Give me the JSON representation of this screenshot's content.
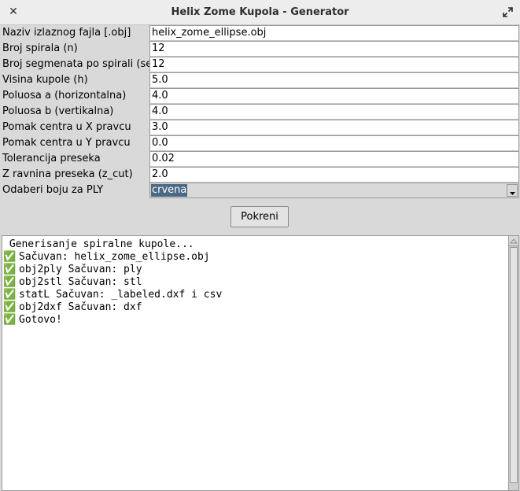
{
  "window": {
    "title": "Helix Zome Kupola - Generator",
    "close_glyph": "✕",
    "icons": {
      "close": "close-icon",
      "maximize": "maximize-icon"
    }
  },
  "form": {
    "fields": [
      {
        "label": "Naziv izlaznog fajla [.obj]",
        "value": "helix_zome_ellipse.obj"
      },
      {
        "label": "Broj spirala (n)",
        "value": "12"
      },
      {
        "label": "Broj segmenata po spirali (segs)",
        "value": "12"
      },
      {
        "label": "Visina kupole (h)",
        "value": "5.0"
      },
      {
        "label": "Poluosa a (horizontalna)",
        "value": "4.0"
      },
      {
        "label": "Poluosa b (vertikalna)",
        "value": "4.0"
      },
      {
        "label": "Pomak centra u X pravcu",
        "value": "3.0"
      },
      {
        "label": "Pomak centra u Y pravcu",
        "value": "0.0"
      },
      {
        "label": "Tolerancija preseka",
        "value": "0.02"
      },
      {
        "label": "Z ravnina preseka (z_cut)",
        "value": "2.0"
      }
    ],
    "color_select": {
      "label": "Odaberi boju za PLY",
      "value": "crvena"
    }
  },
  "run_button": {
    "label": "Pokreni"
  },
  "log": {
    "check_glyph": "✅",
    "lines": [
      {
        "check": false,
        "text": " Generisanje spiralne kupole..."
      },
      {
        "check": true,
        "text": "Sačuvan: helix_zome_ellipse.obj"
      },
      {
        "check": true,
        "text": "obj2ply Sačuvan: ply"
      },
      {
        "check": true,
        "text": "obj2stl Sačuvan: stl"
      },
      {
        "check": true,
        "text": "statL Sačuvan: _labeled.dxf i csv"
      },
      {
        "check": true,
        "text": "obj2dxf Sačuvan: dxf"
      },
      {
        "check": true,
        "text": "Gotovo!"
      }
    ]
  },
  "colors": {
    "selection": "#4a6984",
    "check": "#7aa86a",
    "window_bg": "#d9d9d9"
  }
}
